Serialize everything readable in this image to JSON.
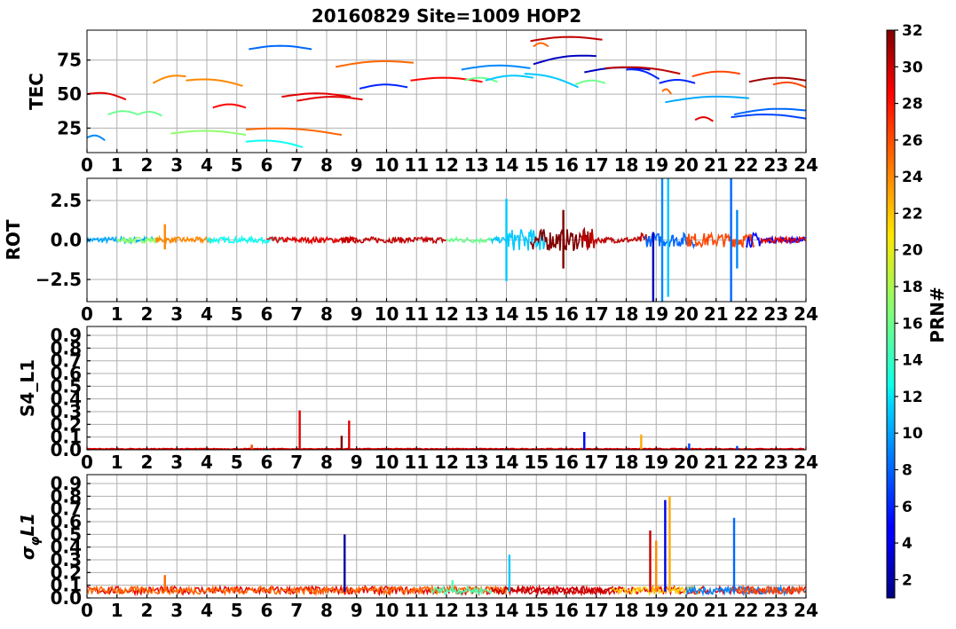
{
  "chart_data": {
    "type": "line",
    "title": "20160829 Site=1009 HOP2",
    "colorbar": {
      "label": "PRN#",
      "min": 1,
      "max": 32,
      "colormap": "jet",
      "ticks": [
        "2",
        "4",
        "6",
        "8",
        "10",
        "12",
        "14",
        "16",
        "18",
        "20",
        "22",
        "24",
        "26",
        "28",
        "30",
        "32"
      ]
    },
    "panels": [
      {
        "name": "tec",
        "ylabel": "TEC",
        "ylim": [
          7,
          97
        ],
        "yticks": [
          25,
          50,
          75
        ],
        "ytick_labels": [
          "25",
          "50",
          "75"
        ],
        "xlim": [
          0,
          24
        ],
        "xticks": [
          0,
          1,
          2,
          3,
          4,
          5,
          6,
          7,
          8,
          9,
          10,
          11,
          12,
          13,
          14,
          15,
          16,
          17,
          18,
          19,
          20,
          21,
          22,
          23,
          24
        ],
        "xtick_labels": [
          "0",
          "1",
          "2",
          "3",
          "4",
          "5",
          "6",
          "7",
          "8",
          "9",
          "10",
          "11",
          "12",
          "13",
          "14",
          "15",
          "16",
          "17",
          "18",
          "19",
          "20",
          "21",
          "22",
          "23",
          "24"
        ],
        "grid": true,
        "arcs": [
          {
            "prn": 9,
            "x": [
              0,
              0.6
            ],
            "y": [
              18,
              16
            ]
          },
          {
            "prn": 29,
            "x": [
              0,
              1.3
            ],
            "y": [
              50,
              46
            ]
          },
          {
            "prn": 16,
            "x": [
              0.7,
              1.7
            ],
            "y": [
              35,
              35
            ]
          },
          {
            "prn": 16,
            "x": [
              1.7,
              2.5
            ],
            "y": [
              35,
              34
            ]
          },
          {
            "prn": 24,
            "x": [
              2.2,
              3.3
            ],
            "y": [
              58,
              63
            ]
          },
          {
            "prn": 24,
            "x": [
              3.3,
              5.2
            ],
            "y": [
              60,
              56
            ]
          },
          {
            "prn": 17,
            "x": [
              2.8,
              5.3
            ],
            "y": [
              21,
              20
            ]
          },
          {
            "prn": 28,
            "x": [
              4.2,
              5.3
            ],
            "y": [
              40,
              40
            ]
          },
          {
            "prn": 8,
            "x": [
              5.4,
              7.5
            ],
            "y": [
              83,
              83
            ]
          },
          {
            "prn": 13,
            "x": [
              5.3,
              7.2
            ],
            "y": [
              15,
              11
            ]
          },
          {
            "prn": 25,
            "x": [
              5.3,
              8.5
            ],
            "y": [
              24,
              20
            ]
          },
          {
            "prn": 29,
            "x": [
              6.5,
              8.8
            ],
            "y": [
              48,
              48
            ]
          },
          {
            "prn": 29,
            "x": [
              7.0,
              9.2
            ],
            "y": [
              45,
              46
            ]
          },
          {
            "prn": 25,
            "x": [
              8.3,
              10.9
            ],
            "y": [
              70,
              73
            ]
          },
          {
            "prn": 6,
            "x": [
              9.1,
              10.7
            ],
            "y": [
              54,
              55
            ]
          },
          {
            "prn": 28,
            "x": [
              10.8,
              13.2
            ],
            "y": [
              60,
              59
            ]
          },
          {
            "prn": 9,
            "x": [
              12.5,
              14.8
            ],
            "y": [
              68,
              69
            ]
          },
          {
            "prn": 16,
            "x": [
              12.6,
              13.7
            ],
            "y": [
              60,
              59
            ]
          },
          {
            "prn": 11,
            "x": [
              13.3,
              14.9
            ],
            "y": [
              60,
              62
            ]
          },
          {
            "prn": 30,
            "x": [
              14.8,
              17.2
            ],
            "y": [
              89,
              90
            ]
          },
          {
            "prn": 25,
            "x": [
              14.9,
              15.4
            ],
            "y": [
              85,
              85
            ]
          },
          {
            "prn": 3,
            "x": [
              14.9,
              17.0
            ],
            "y": [
              72,
              78
            ]
          },
          {
            "prn": 11,
            "x": [
              14.6,
              16.4
            ],
            "y": [
              65,
              55
            ]
          },
          {
            "prn": 16,
            "x": [
              16.3,
              17.3
            ],
            "y": [
              57,
              58
            ]
          },
          {
            "prn": 3,
            "x": [
              16.6,
              18.8
            ],
            "y": [
              66,
              68
            ]
          },
          {
            "prn": 30,
            "x": [
              17.3,
              19.8
            ],
            "y": [
              69,
              65
            ]
          },
          {
            "prn": 6,
            "x": [
              18.0,
              19.1
            ],
            "y": [
              68,
              61
            ]
          },
          {
            "prn": 6,
            "x": [
              19.1,
              20.3
            ],
            "y": [
              58,
              58
            ]
          },
          {
            "prn": 25,
            "x": [
              19.2,
              19.5
            ],
            "y": [
              52,
              50
            ]
          },
          {
            "prn": 10,
            "x": [
              19.3,
              22.1
            ],
            "y": [
              44,
              47
            ]
          },
          {
            "prn": 26,
            "x": [
              20.2,
              21.8
            ],
            "y": [
              63,
              65
            ]
          },
          {
            "prn": 29,
            "x": [
              20.3,
              20.9
            ],
            "y": [
              31,
              30
            ]
          },
          {
            "prn": 31,
            "x": [
              22.1,
              24
            ],
            "y": [
              59,
              60
            ]
          },
          {
            "prn": 26,
            "x": [
              22.9,
              24
            ],
            "y": [
              57,
              55
            ]
          },
          {
            "prn": 7,
            "x": [
              21.5,
              24
            ],
            "y": [
              33,
              32
            ]
          },
          {
            "prn": 8,
            "x": [
              21.6,
              24
            ],
            "y": [
              35,
              38
            ]
          }
        ]
      },
      {
        "name": "rot",
        "ylabel": "ROT",
        "ylim": [
          -3.9,
          3.9
        ],
        "yticks": [
          -2.5,
          0.0,
          2.5
        ],
        "ytick_labels": [
          "−2.5",
          "0.0",
          "2.5"
        ],
        "xlim": [
          0,
          24
        ],
        "xticks": [
          0,
          1,
          2,
          3,
          4,
          5,
          6,
          7,
          8,
          9,
          10,
          11,
          12,
          13,
          14,
          15,
          16,
          17,
          18,
          19,
          20,
          21,
          22,
          23,
          24
        ],
        "xtick_labels": [
          "0",
          "1",
          "2",
          "3",
          "4",
          "5",
          "6",
          "7",
          "8",
          "9",
          "10",
          "11",
          "12",
          "13",
          "14",
          "15",
          "16",
          "17",
          "18",
          "19",
          "20",
          "21",
          "22",
          "23",
          "24"
        ],
        "grid": true,
        "spikes": [
          {
            "prn": 24,
            "x": 2.6,
            "y": [
              -0.6,
              1.0
            ]
          },
          {
            "prn": 11,
            "x": 14.0,
            "y": [
              -2.6,
              2.6
            ]
          },
          {
            "prn": 32,
            "x": 15.9,
            "y": [
              -1.8,
              1.9
            ]
          },
          {
            "prn": 3,
            "x": 18.9,
            "y": [
              -3.9,
              0.5
            ]
          },
          {
            "prn": 9,
            "x": 19.2,
            "y": [
              -3.9,
              3.9
            ]
          },
          {
            "prn": 11,
            "x": 19.4,
            "y": [
              -3.6,
              3.9
            ]
          },
          {
            "prn": 8,
            "x": 21.5,
            "y": [
              -3.9,
              3.9
            ]
          },
          {
            "prn": 9,
            "x": 21.7,
            "y": [
              -1.8,
              1.9
            ]
          }
        ]
      },
      {
        "name": "s4",
        "ylabel": "S4_L1",
        "ylim": [
          0.0,
          0.97
        ],
        "yticks": [
          0.0,
          0.1,
          0.2,
          0.3,
          0.4,
          0.5,
          0.6,
          0.7,
          0.8,
          0.9
        ],
        "ytick_labels": [
          "0.0",
          "0.1",
          "0.2",
          "0.3",
          "0.4",
          "0.5",
          "0.6",
          "0.7",
          "0.8",
          "0.9"
        ],
        "xlim": [
          0,
          24
        ],
        "xticks": [
          0,
          1,
          2,
          3,
          4,
          5,
          6,
          7,
          8,
          9,
          10,
          11,
          12,
          13,
          14,
          15,
          16,
          17,
          18,
          19,
          20,
          21,
          22,
          23,
          24
        ],
        "xtick_labels": [
          "0",
          "1",
          "2",
          "3",
          "4",
          "5",
          "6",
          "7",
          "8",
          "9",
          "10",
          "11",
          "12",
          "13",
          "14",
          "15",
          "16",
          "17",
          "18",
          "19",
          "20",
          "21",
          "22",
          "23",
          "24"
        ],
        "grid": true,
        "spikes": [
          {
            "prn": 26,
            "x": 5.5,
            "y": [
              0.0,
              0.04
            ]
          },
          {
            "prn": 29,
            "x": 7.1,
            "y": [
              0.0,
              0.31
            ]
          },
          {
            "prn": 32,
            "x": 8.5,
            "y": [
              0.0,
              0.11
            ]
          },
          {
            "prn": 29,
            "x": 8.75,
            "y": [
              0.0,
              0.23
            ]
          },
          {
            "prn": 5,
            "x": 16.6,
            "y": [
              0.0,
              0.14
            ]
          },
          {
            "prn": 23,
            "x": 18.5,
            "y": [
              0.0,
              0.12
            ]
          },
          {
            "prn": 7,
            "x": 20.1,
            "y": [
              0.0,
              0.05
            ]
          },
          {
            "prn": 7,
            "x": 21.7,
            "y": [
              0.0,
              0.03
            ]
          }
        ]
      },
      {
        "name": "sigma",
        "ylabel": "σ_φL1",
        "ylim": [
          0.0,
          0.97
        ],
        "yticks": [
          0.0,
          0.1,
          0.2,
          0.3,
          0.4,
          0.5,
          0.6,
          0.7,
          0.8,
          0.9
        ],
        "ytick_labels": [
          "0.0",
          "0.1",
          "0.2",
          "0.3",
          "0.4",
          "0.5",
          "0.6",
          "0.7",
          "0.8",
          "0.9"
        ],
        "xlim": [
          0,
          24
        ],
        "xticks": [
          0,
          1,
          2,
          3,
          4,
          5,
          6,
          7,
          8,
          9,
          10,
          11,
          12,
          13,
          14,
          15,
          16,
          17,
          18,
          19,
          20,
          21,
          22,
          23,
          24
        ],
        "xtick_labels": [
          "0",
          "1",
          "2",
          "3",
          "4",
          "5",
          "6",
          "7",
          "8",
          "9",
          "10",
          "11",
          "12",
          "13",
          "14",
          "15",
          "16",
          "17",
          "18",
          "19",
          "20",
          "21",
          "22",
          "23",
          "24"
        ],
        "grid": true,
        "spikes": [
          {
            "prn": 25,
            "x": 2.6,
            "y": [
              0.05,
              0.18
            ]
          },
          {
            "prn": 2,
            "x": 8.6,
            "y": [
              0.05,
              0.5
            ]
          },
          {
            "prn": 15,
            "x": 12.2,
            "y": [
              0.05,
              0.14
            ]
          },
          {
            "prn": 11,
            "x": 14.1,
            "y": [
              0.05,
              0.34
            ]
          },
          {
            "prn": 30,
            "x": 18.8,
            "y": [
              0.05,
              0.53
            ]
          },
          {
            "prn": 24,
            "x": 19.0,
            "y": [
              0.05,
              0.45
            ]
          },
          {
            "prn": 4,
            "x": 19.3,
            "y": [
              0.05,
              0.77
            ]
          },
          {
            "prn": 23,
            "x": 19.45,
            "y": [
              0.05,
              0.8
            ]
          },
          {
            "prn": 8,
            "x": 21.6,
            "y": [
              0.05,
              0.63
            ]
          }
        ]
      }
    ]
  }
}
